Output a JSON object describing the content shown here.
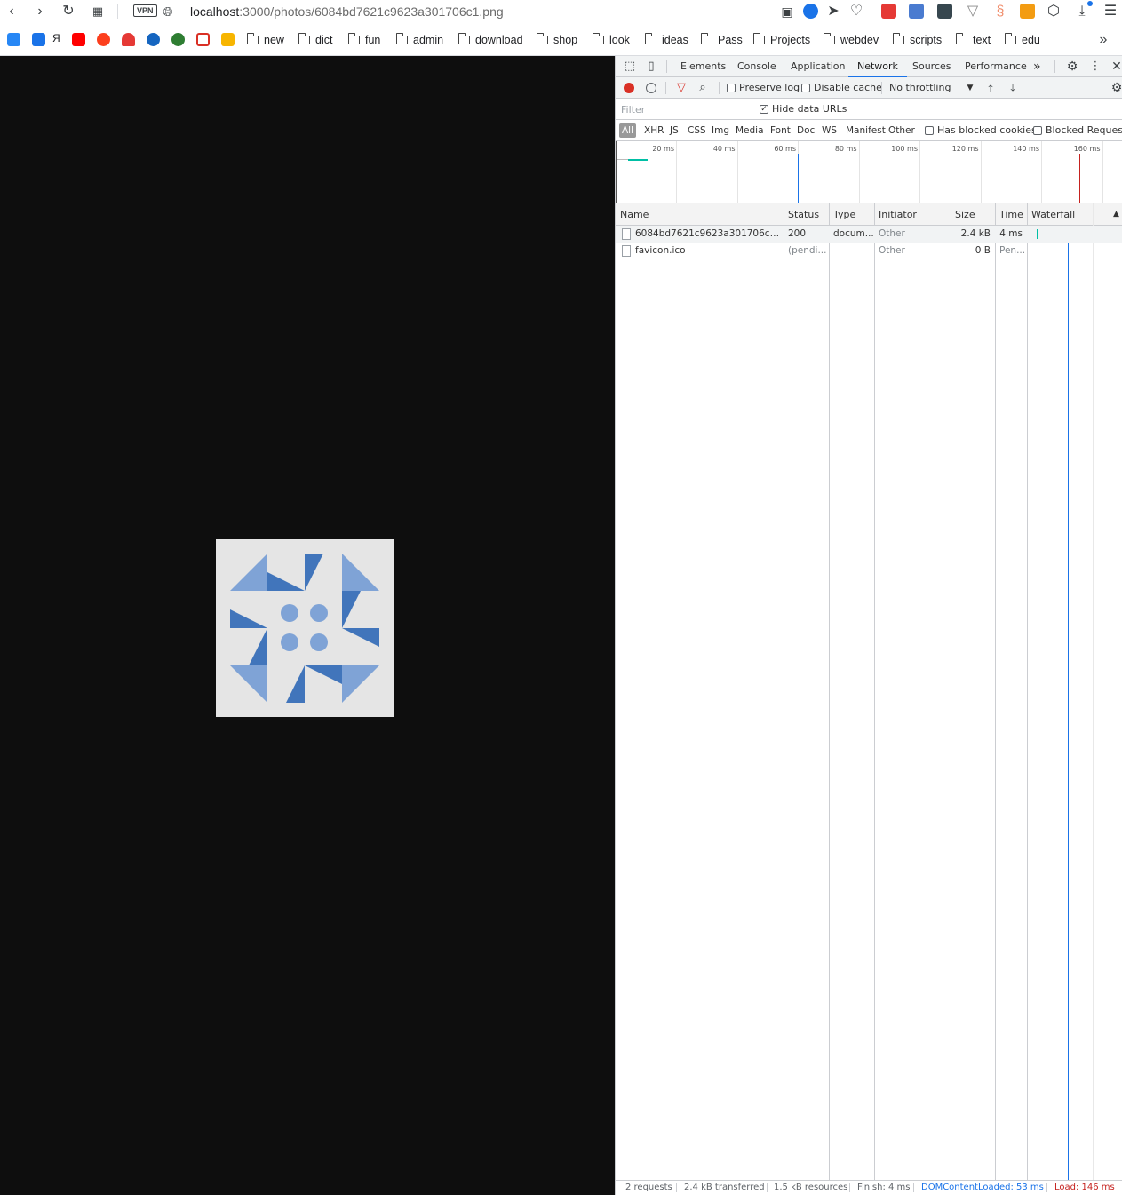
{
  "toolbar": {
    "vpn_label": "VPN",
    "url_host": "localhost",
    "url_path": ":3000/photos/6084bd7621c9623a301706c1.png"
  },
  "bookmarks": {
    "ya_label": "Я",
    "folders": [
      "new",
      "dict",
      "fun",
      "admin",
      "download",
      "shop",
      "look",
      "ideas",
      "Pass",
      "Projects",
      "webdev",
      "scripts",
      "text",
      "edu"
    ]
  },
  "devtools": {
    "tabs": [
      "Elements",
      "Console",
      "Application",
      "Network",
      "Sources",
      "Performance"
    ],
    "active_tab": "Network",
    "preserve_log": "Preserve log",
    "disable_cache": "Disable cache",
    "throttling": "No throttling",
    "filter_placeholder": "Filter",
    "hide_data_urls": "Hide data URLs",
    "types": [
      "All",
      "XHR",
      "JS",
      "CSS",
      "Img",
      "Media",
      "Font",
      "Doc",
      "WS",
      "Manifest",
      "Other"
    ],
    "has_blocked_cookies": "Has blocked cookies",
    "blocked_requests": "Blocked Requests",
    "timeline_labels": [
      "20 ms",
      "40 ms",
      "60 ms",
      "80 ms",
      "100 ms",
      "120 ms",
      "140 ms",
      "160 ms"
    ],
    "columns": [
      "Name",
      "Status",
      "Type",
      "Initiator",
      "Size",
      "Time",
      "Waterfall"
    ],
    "rows": [
      {
        "name": "6084bd7621c9623a301706c1.png",
        "status": "200",
        "type": "docum...",
        "initiator": "Other",
        "size": "2.4 kB",
        "time": "4 ms"
      },
      {
        "name": "favicon.ico",
        "status": "(pendi...",
        "type": "",
        "initiator": "Other",
        "size": "0 B",
        "time": "Pen..."
      }
    ],
    "status_bar": {
      "requests": "2 requests",
      "transferred": "2.4 kB transferred",
      "resources": "1.5 kB resources",
      "finish": "Finish: 4 ms",
      "dom_content_loaded": "DOMContentLoaded: 53 ms",
      "load": "Load: 146 ms"
    },
    "colors": {
      "dcl": "#1a73e8",
      "load": "#c5221f",
      "waterfall_bar": "#00bfa5"
    }
  }
}
